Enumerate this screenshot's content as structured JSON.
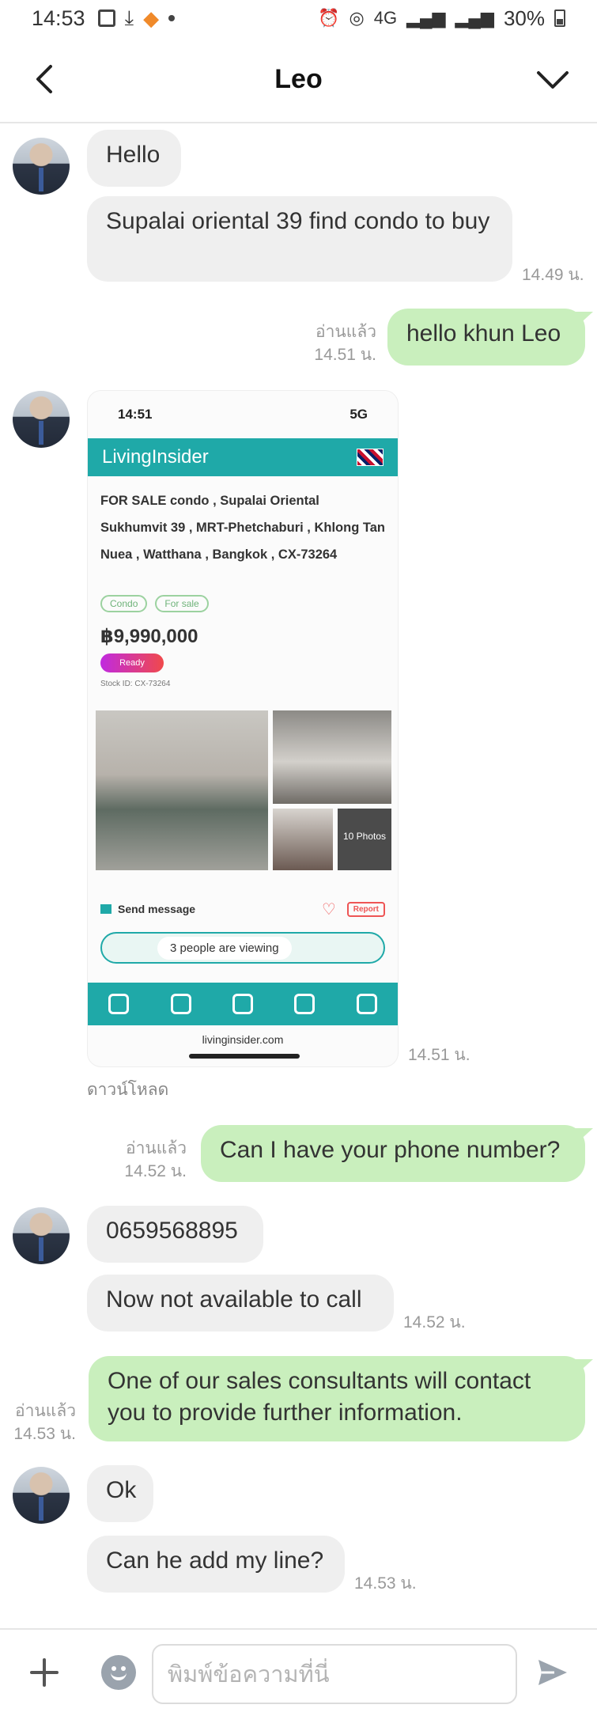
{
  "status_bar": {
    "time": "14:53",
    "network": "4G",
    "battery": "30%"
  },
  "header": {
    "title": "Leo"
  },
  "messages": [
    {
      "text": "Hello"
    },
    {
      "text": "Supalai oriental 39 find condo to buy",
      "time": "14.49 น."
    },
    {
      "text": "hello khun Leo",
      "read": "อ่านแล้ว",
      "time": "14.51 น."
    },
    {
      "image_time": "14.51 น.",
      "download": "ดาวน์โหลด"
    },
    {
      "text": "Can I have your phone number?",
      "read": "อ่านแล้ว",
      "time": "14.52 น."
    },
    {
      "text": "0659568895"
    },
    {
      "text": "Now not available to call",
      "time": "14.52 น."
    },
    {
      "text": "One of our sales consultants will contact you to provide further information.",
      "read": "อ่านแล้ว",
      "time": "14.53 น."
    },
    {
      "text": "Ok"
    },
    {
      "text": "Can he add my line?",
      "time": "14.53 น."
    }
  ],
  "screenshot": {
    "status_time": "14:51",
    "status_right": "5G",
    "brand": "LivingInsider",
    "title": "FOR SALE condo , Supalai Oriental Sukhumvit 39 , MRT-Phetchaburi , Khlong Tan Nuea , Watthana , Bangkok , CX-73264",
    "tags": [
      "Condo",
      "For sale"
    ],
    "price": "฿9,990,000",
    "ready": "Ready",
    "stock": "Stock ID: CX-73264",
    "more_photos": "10 Photos",
    "send_message": "Send message",
    "report": "Report",
    "viewing": "3 people are viewing",
    "url": "livinginsider.com"
  },
  "input": {
    "placeholder": "พิมพ์ข้อความที่นี่"
  },
  "colors": {
    "outgoing_bubble": "#c9efbd",
    "incoming_bubble": "#efefef",
    "accent": "#1fa9a8"
  }
}
